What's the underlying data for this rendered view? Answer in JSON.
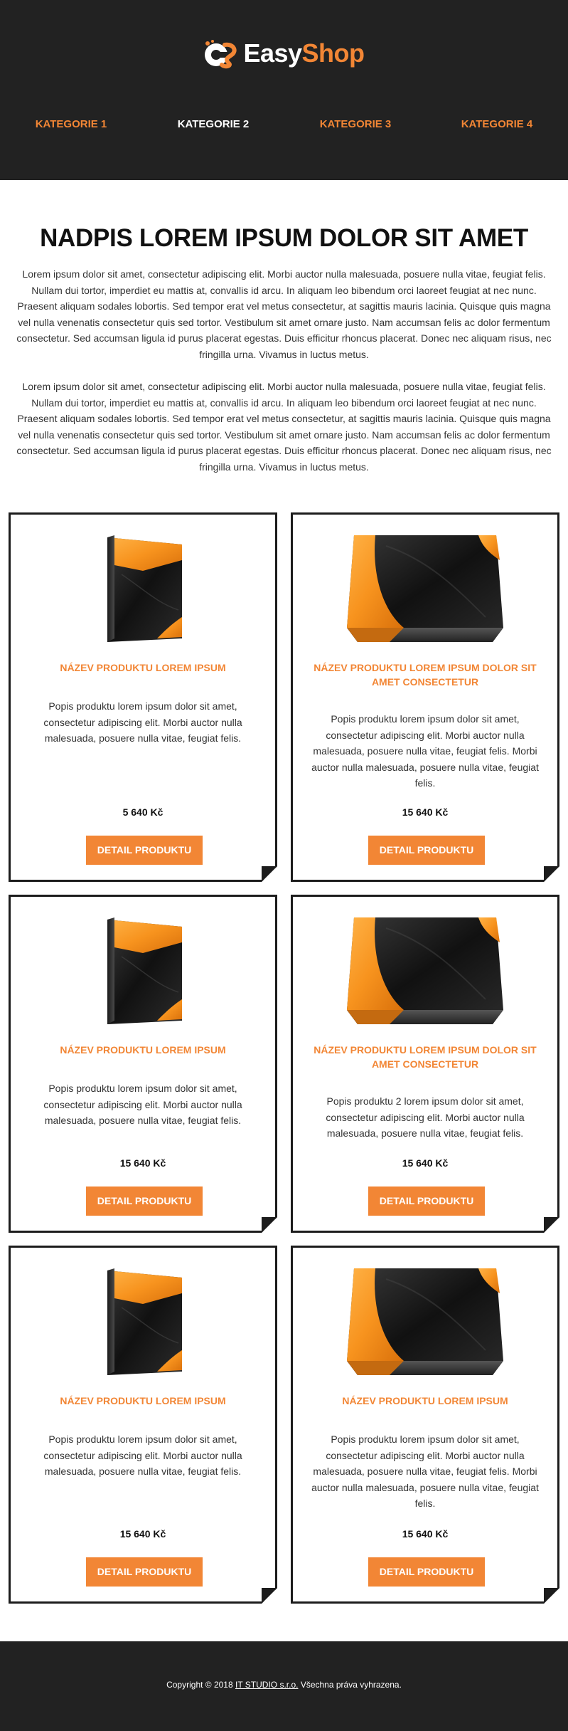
{
  "brand": {
    "name_part1": "Easy",
    "name_part2": "Shop",
    "accent_color": "#f28635",
    "dark_color": "#222222"
  },
  "nav": {
    "items": [
      {
        "label": "KATEGORIE 1",
        "active": false
      },
      {
        "label": "KATEGORIE 2",
        "active": true
      },
      {
        "label": "KATEGORIE 3",
        "active": false
      },
      {
        "label": "KATEGORIE 4",
        "active": false
      }
    ]
  },
  "content": {
    "title": "NADPIS LOREM IPSUM DOLOR SIT AMET",
    "paragraph1": "Lorem ipsum dolor sit amet, consectetur adipiscing elit. Morbi auctor nulla malesuada, posuere nulla vitae, feugiat felis. Nullam dui tortor, imperdiet eu mattis at, convallis id arcu. In aliquam leo bibendum orci laoreet feugiat at nec nunc. Praesent aliquam sodales lobortis. Sed tempor erat vel metus consectetur, at sagittis mauris lacinia. Quisque quis magna vel nulla venenatis consectetur quis sed tortor. Vestibulum sit amet ornare justo. Nam accumsan felis ac dolor fermentum consectetur. Sed accumsan ligula id purus placerat egestas. Duis efficitur rhoncus placerat. Donec nec aliquam risus, nec fringilla urna. Vivamus in luctus metus.",
    "paragraph2": "Lorem ipsum dolor sit amet, consectetur adipiscing elit. Morbi auctor nulla malesuada, posuere nulla vitae, feugiat felis. Nullam dui tortor, imperdiet eu mattis at, convallis id arcu. In aliquam leo bibendum orci laoreet feugiat at nec nunc. Praesent aliquam sodales lobortis. Sed tempor erat vel metus consectetur, at sagittis mauris lacinia. Quisque quis magna vel nulla venenatis consectetur quis sed tortor. Vestibulum sit amet ornare justo. Nam accumsan felis ac dolor fermentum consectetur. Sed accumsan ligula id purus placerat egestas. Duis efficitur rhoncus placerat. Donec nec aliquam risus, nec fringilla urna. Vivamus in luctus metus."
  },
  "products": [
    {
      "name": "NÁZEV PRODUKTU LOREM IPSUM",
      "description": "Popis produktu lorem ipsum dolor sit amet, consectetur adipiscing elit. Morbi auctor nulla malesuada, posuere nulla vitae, feugiat felis.",
      "price": "5 640 Kč",
      "button": "DETAIL PRODUKTU",
      "image": "tall-box-icon"
    },
    {
      "name": "NÁZEV PRODUKTU LOREM IPSUM DOLOR SIT AMET CONSECTETUR",
      "description": "Popis produktu lorem ipsum dolor sit amet, consectetur adipiscing elit. Morbi auctor nulla malesuada, posuere nulla vitae, feugiat felis. Morbi auctor nulla malesuada, posuere nulla vitae, feugiat felis.",
      "price": "15 640 Kč",
      "button": "DETAIL PRODUKTU",
      "image": "wide-box-icon"
    },
    {
      "name": "NÁZEV PRODUKTU LOREM IPSUM",
      "description": "Popis produktu lorem ipsum dolor sit amet, consectetur adipiscing elit. Morbi auctor nulla malesuada, posuere nulla vitae, feugiat felis.",
      "price": "15 640 Kč",
      "button": "DETAIL PRODUKTU",
      "image": "tall-box-icon"
    },
    {
      "name": "NÁZEV PRODUKTU LOREM IPSUM DOLOR SIT AMET CONSECTETUR",
      "description": "Popis produktu 2 lorem ipsum dolor sit amet, consectetur adipiscing elit. Morbi auctor nulla malesuada, posuere nulla vitae, feugiat felis.",
      "price": "15 640 Kč",
      "button": "DETAIL PRODUKTU",
      "image": "wide-box-icon"
    },
    {
      "name": "NÁZEV PRODUKTU LOREM IPSUM",
      "description": "Popis produktu lorem ipsum dolor sit amet, consectetur adipiscing elit. Morbi auctor nulla malesuada, posuere nulla vitae, feugiat felis.",
      "price": "15 640 Kč",
      "button": "DETAIL PRODUKTU",
      "image": "tall-box-icon"
    },
    {
      "name": "NÁZEV PRODUKTU LOREM IPSUM",
      "description": "Popis produktu lorem ipsum dolor sit amet, consectetur adipiscing elit. Morbi auctor nulla malesuada, posuere nulla vitae, feugiat felis. Morbi auctor nulla malesuada, posuere nulla vitae, feugiat felis.",
      "price": "15 640 Kč",
      "button": "DETAIL PRODUKTU",
      "image": "wide-box-icon"
    }
  ],
  "footer": {
    "prefix": "Copyright © 2018",
    "company": "IT STUDIO s.r.o.",
    "suffix": "Všechna práva vyhrazena."
  }
}
